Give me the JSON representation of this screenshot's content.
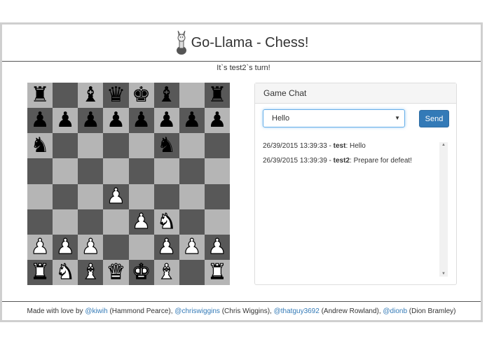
{
  "header": {
    "title": "Go-Llama - Chess!",
    "logo_icon": "llama-icon"
  },
  "turn_text": "It`s test2`s turn!",
  "board": {
    "light_color": "#b5b5b5",
    "dark_color": "#585858",
    "ranks": [
      [
        "br",
        "",
        "bb",
        "bq",
        "bk",
        "bb",
        "",
        "br"
      ],
      [
        "bp",
        "bp",
        "bp",
        "bp",
        "bp",
        "bp",
        "bp",
        "bp"
      ],
      [
        "bn",
        "",
        "",
        "",
        "",
        "bn",
        "",
        ""
      ],
      [
        "",
        "",
        "",
        "",
        "",
        "",
        "",
        ""
      ],
      [
        "",
        "",
        "",
        "wp",
        "",
        "",
        "",
        ""
      ],
      [
        "",
        "",
        "",
        "",
        "wp",
        "wn",
        "",
        ""
      ],
      [
        "wp",
        "wp",
        "wp",
        "",
        "",
        "wp",
        "wp",
        "wp"
      ],
      [
        "wr",
        "wn",
        "wb",
        "wq",
        "wk",
        "wb",
        "",
        "wr"
      ]
    ]
  },
  "chat": {
    "title": "Game Chat",
    "selected_message": "Hello",
    "send_label": "Send",
    "send_color": "#337ab7",
    "messages": [
      {
        "timestamp": "26/39/2015 13:39:33",
        "user": "test",
        "text": "Hello"
      },
      {
        "timestamp": "26/39/2015 13:39:39",
        "user": "test2",
        "text": "Prepare for defeat!"
      }
    ]
  },
  "footer": {
    "prefix": "Made with love by ",
    "credits": [
      {
        "handle": "@kiwih",
        "name": "(Hammond Pearce)"
      },
      {
        "handle": "@chriswiggins",
        "name": "(Chris Wiggins)"
      },
      {
        "handle": "@thatguy3692",
        "name": "(Andrew Rowland)"
      },
      {
        "handle": "@dionb",
        "name": "(Dion Bramley)"
      }
    ]
  }
}
